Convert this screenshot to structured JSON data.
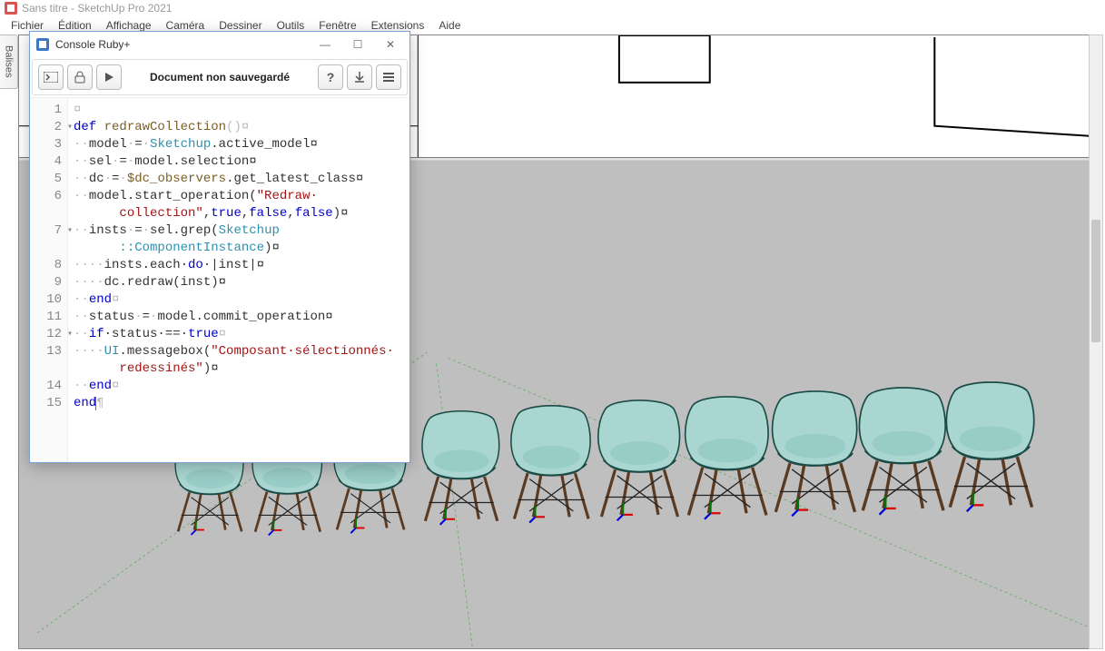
{
  "app": {
    "title": "Sans titre - SketchUp Pro 2021",
    "balises_label": "Balises"
  },
  "menu": {
    "items": [
      "Fichier",
      "Édition",
      "Affichage",
      "Caméra",
      "Dessiner",
      "Outils",
      "Fenêtre",
      "Extensions",
      "Aide"
    ]
  },
  "console": {
    "title": "Console Ruby+",
    "status": "Document non sauvegardé",
    "winbuttons": {
      "minimize": "—",
      "maximize": "☐",
      "close": "✕"
    },
    "toolbar_icons": {
      "run_console": "run-console-icon",
      "open": "open-icon",
      "play": "play-icon",
      "help": "help-icon",
      "download": "download-icon",
      "menu": "menu-icon"
    },
    "code": {
      "line_numbers": [
        1,
        2,
        3,
        4,
        5,
        6,
        7,
        8,
        9,
        10,
        11,
        12,
        13,
        14,
        15
      ],
      "fold_lines": [
        2,
        7,
        12
      ],
      "lines": [
        {
          "segments": [
            {
              "t": "¤",
              "c": "ws"
            }
          ]
        },
        {
          "segments": [
            {
              "t": "def",
              "c": "kw"
            },
            {
              "t": " "
            },
            {
              "t": "redrawCollection",
              "c": "var"
            },
            {
              "t": "()¤",
              "c": "ws"
            }
          ]
        },
        {
          "segments": [
            {
              "t": "··",
              "c": "ws"
            },
            {
              "t": "model"
            },
            {
              "t": "·",
              "c": "ws"
            },
            {
              "t": "="
            },
            {
              "t": "·",
              "c": "ws"
            },
            {
              "t": "Sketchup",
              "c": "const"
            },
            {
              "t": ".active_model¤",
              "c": ""
            }
          ]
        },
        {
          "segments": [
            {
              "t": "··",
              "c": "ws"
            },
            {
              "t": "sel"
            },
            {
              "t": "·",
              "c": "ws"
            },
            {
              "t": "="
            },
            {
              "t": "·",
              "c": "ws"
            },
            {
              "t": "model.selection¤"
            }
          ]
        },
        {
          "segments": [
            {
              "t": "··",
              "c": "ws"
            },
            {
              "t": "dc"
            },
            {
              "t": "·",
              "c": "ws"
            },
            {
              "t": "="
            },
            {
              "t": "·",
              "c": "ws"
            },
            {
              "t": "$dc_observers",
              "c": "var"
            },
            {
              "t": ".get_latest_class¤"
            }
          ]
        },
        {
          "segments": [
            {
              "t": "··",
              "c": "ws"
            },
            {
              "t": "model.start_operation("
            },
            {
              "t": "\"Redraw·",
              "c": "str"
            }
          ]
        },
        {
          "segments": [
            {
              "t": "      ",
              "c": ""
            },
            {
              "t": "collection\"",
              "c": "str"
            },
            {
              "t": ","
            },
            {
              "t": "true",
              "c": "bool"
            },
            {
              "t": ","
            },
            {
              "t": "false",
              "c": "bool"
            },
            {
              "t": ","
            },
            {
              "t": "false",
              "c": "bool"
            },
            {
              "t": ")¤"
            }
          ]
        },
        {
          "segments": [
            {
              "t": "··",
              "c": "ws"
            },
            {
              "t": "insts"
            },
            {
              "t": "·",
              "c": "ws"
            },
            {
              "t": "="
            },
            {
              "t": "·",
              "c": "ws"
            },
            {
              "t": "sel.grep("
            },
            {
              "t": "Sketchup",
              "c": "const"
            }
          ]
        },
        {
          "segments": [
            {
              "t": "      "
            },
            {
              "t": "::ComponentInstance",
              "c": "const"
            },
            {
              "t": ")¤"
            }
          ]
        },
        {
          "segments": [
            {
              "t": "····",
              "c": "ws"
            },
            {
              "t": "insts.each·"
            },
            {
              "t": "do",
              "c": "kw"
            },
            {
              "t": "·|inst|¤"
            }
          ]
        },
        {
          "segments": [
            {
              "t": "····",
              "c": "ws"
            },
            {
              "t": "dc.redraw(inst)¤"
            }
          ]
        },
        {
          "segments": [
            {
              "t": "··",
              "c": "ws"
            },
            {
              "t": "end",
              "c": "kw"
            },
            {
              "t": "¤",
              "c": "ws"
            }
          ]
        },
        {
          "segments": [
            {
              "t": "··",
              "c": "ws"
            },
            {
              "t": "status"
            },
            {
              "t": "·",
              "c": "ws"
            },
            {
              "t": "="
            },
            {
              "t": "·",
              "c": "ws"
            },
            {
              "t": "model.commit_operation¤"
            }
          ]
        },
        {
          "segments": [
            {
              "t": "··",
              "c": "ws"
            },
            {
              "t": "if",
              "c": "kw"
            },
            {
              "t": "·status·"
            },
            {
              "t": "==",
              "c": ""
            },
            {
              "t": "·"
            },
            {
              "t": "true",
              "c": "bool"
            },
            {
              "t": "¤",
              "c": "ws"
            }
          ]
        },
        {
          "segments": [
            {
              "t": "····",
              "c": "ws"
            },
            {
              "t": "UI",
              "c": "const"
            },
            {
              "t": ".messagebox("
            },
            {
              "t": "\"Composant·sélectionnés·",
              "c": "str"
            }
          ]
        },
        {
          "segments": [
            {
              "t": "      "
            },
            {
              "t": "redessinés\"",
              "c": "str"
            },
            {
              "t": ")¤"
            }
          ]
        },
        {
          "segments": [
            {
              "t": "··",
              "c": "ws"
            },
            {
              "t": "end",
              "c": "kw"
            },
            {
              "t": "¤",
              "c": "ws"
            }
          ]
        },
        {
          "segments": [
            {
              "t": "end",
              "c": "kw"
            },
            {
              "t": "¶",
              "c": "ws"
            }
          ]
        }
      ]
    }
  }
}
